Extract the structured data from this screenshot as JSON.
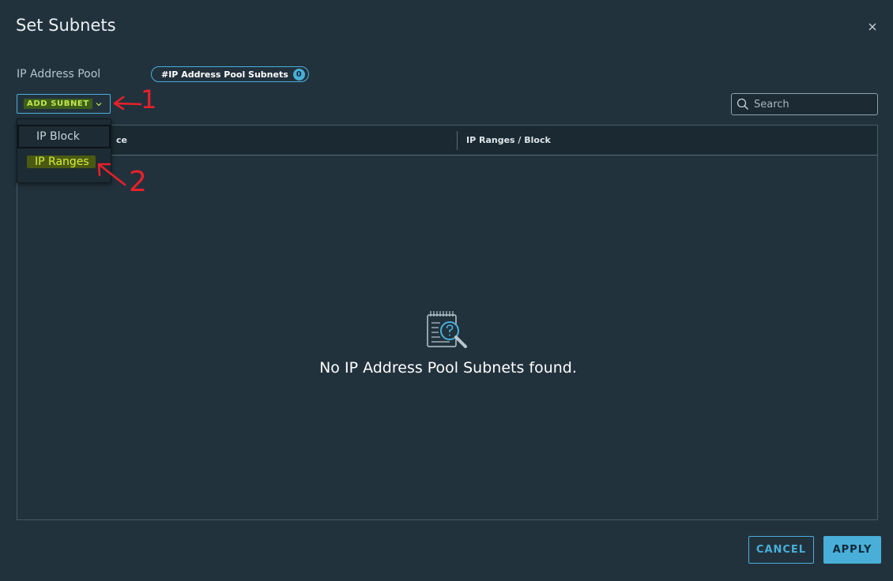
{
  "dialog": {
    "title": "Set Subnets",
    "close_icon": "close-icon"
  },
  "pool": {
    "label": "IP Address Pool",
    "chip_label": "#IP Address Pool Subnets",
    "chip_count": "0"
  },
  "toolbar": {
    "add_subnet_label": "ADD SUBNET",
    "add_subnet_icon": "chevron-down-icon",
    "search_placeholder": "Search",
    "search_value": "",
    "search_icon": "search-icon"
  },
  "dropdown": {
    "items": [
      {
        "label": "IP Block"
      },
      {
        "label": "IP Ranges"
      }
    ]
  },
  "grid": {
    "columns": [
      "ce",
      "IP Ranges / Block"
    ],
    "empty_icon": "empty-search-document-icon",
    "empty_message": "No IP Address Pool Subnets found."
  },
  "annotations": {
    "step1": "1",
    "step2": "2",
    "color": "#e8202a"
  },
  "footer": {
    "cancel_label": "CANCEL",
    "apply_label": "APPLY"
  },
  "colors": {
    "background": "#22323d",
    "accent": "#49afd9",
    "highlight": "#d6ef3a"
  }
}
